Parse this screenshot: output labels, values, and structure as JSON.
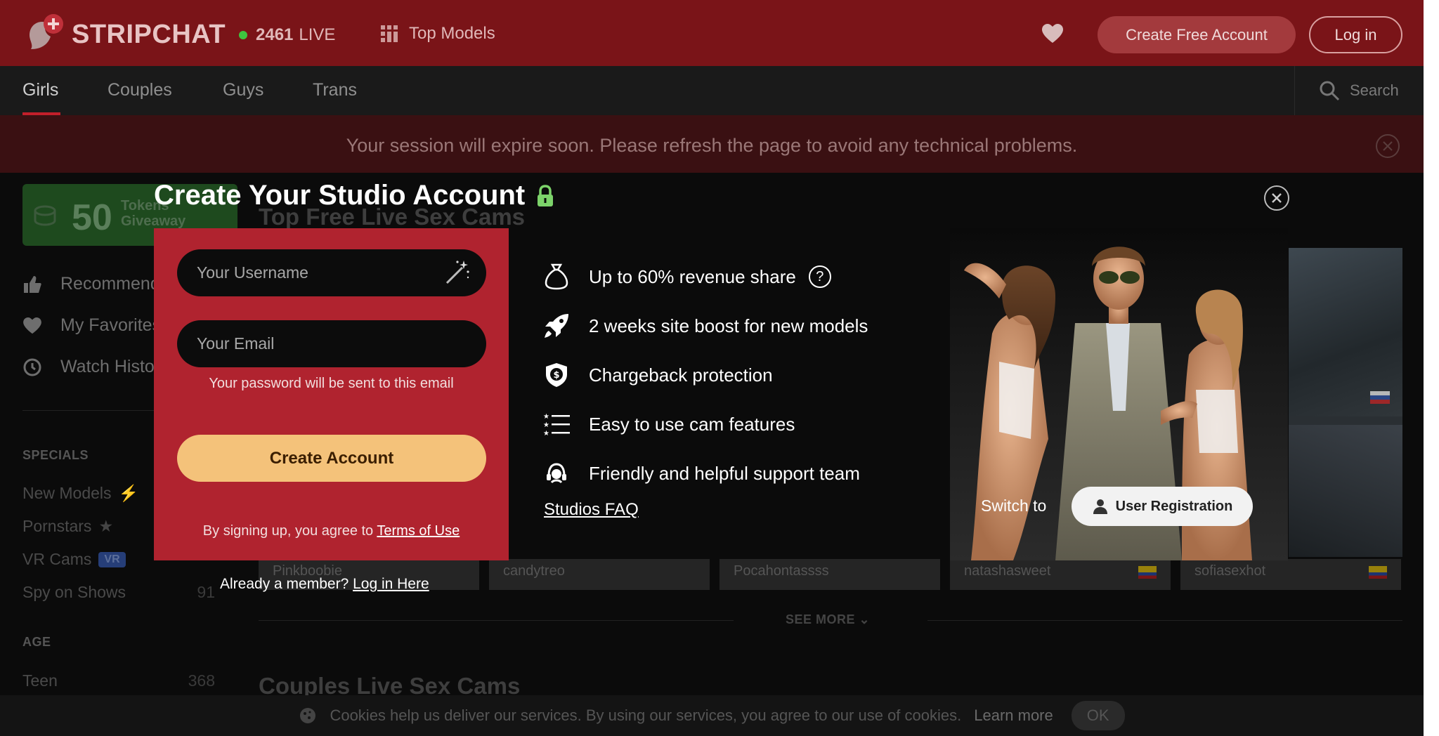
{
  "header": {
    "logo_text": "STRIPCHAT",
    "live_count": "2461",
    "live_label": "LIVE",
    "top_models_label": "Top Models",
    "create_free_label": "Create Free Account",
    "login_label": "Log in"
  },
  "nav": {
    "tabs": [
      {
        "label": "Girls",
        "active": true
      },
      {
        "label": "Couples"
      },
      {
        "label": "Guys"
      },
      {
        "label": "Trans"
      }
    ],
    "search_placeholder": "Search"
  },
  "session_notice": "Your session will expire soon. Please refresh the page to avoid any technical problems.",
  "sidebar": {
    "giveaway_amount": "50",
    "giveaway_text_1": "Tokens",
    "giveaway_text_2": "Giveaway",
    "links": [
      "Recommended",
      "My Favorites",
      "Watch History"
    ],
    "specials_heading": "SPECIALS",
    "specials": [
      {
        "label": "New Models",
        "count": ""
      },
      {
        "label": "Pornstars",
        "count": ""
      },
      {
        "label": "VR Cams",
        "badge": "VR",
        "count": ""
      },
      {
        "label": "Spy on Shows",
        "count": "91"
      }
    ],
    "age_heading": "AGE",
    "age_items": [
      {
        "label": "Teen",
        "count": "368"
      }
    ]
  },
  "main": {
    "section_title": "Top Free Live Sex Cams",
    "cards": [
      "Pinkboobie",
      "candytreo",
      "Pocahontassss",
      "natashasweet",
      "sofiasexhot"
    ],
    "see_more_label": "SEE MORE",
    "couples_title": "Couples Live Sex Cams"
  },
  "cookie": {
    "text": "Cookies help us deliver our services. By using our services, you agree to our use of cookies.",
    "learn_more": "Learn more",
    "ok_label": "OK"
  },
  "modal": {
    "title": "Create Your Studio Account",
    "username_placeholder": "Your Username",
    "email_placeholder": "Your Email",
    "email_hint": "Your password will be sent to this email",
    "create_button": "Create Account",
    "terms_prefix": "By signing up, you agree to",
    "terms_link": "Terms of Use",
    "already_member": "Already a member?",
    "login_here": "Log in Here",
    "features": [
      "Up to 60% revenue share",
      "2 weeks site boost for new models",
      "Chargeback protection",
      "Easy to use cam features",
      "Friendly and helpful support team"
    ],
    "faq_link": "Studios FAQ",
    "switch_to": "Switch to",
    "user_registration": "User Registration"
  },
  "colors": {
    "modal_form_bg": "#b0232f",
    "create_button_bg": "#f4c27a",
    "lock_icon": "#7cd36a",
    "topbar_bg": "#7a1418"
  },
  "icons": {
    "lock": "lock-icon",
    "close": "close-icon",
    "magic_wand": "magic-wand-icon",
    "money_bag": "money-bag-icon",
    "rocket": "rocket-icon",
    "shield": "shield-dollar-icon",
    "list": "list-icon",
    "support": "headset-icon",
    "user": "user-icon"
  }
}
